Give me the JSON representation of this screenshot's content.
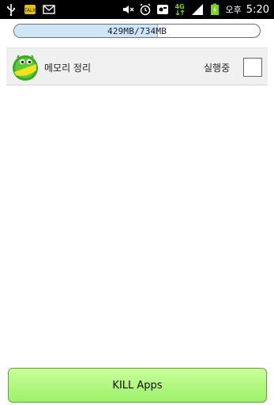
{
  "status_bar": {
    "left_icons": [
      "usb-icon",
      "kakaotalk-icon",
      "email-icon"
    ],
    "right_icons": [
      "mute-icon",
      "alarm-icon",
      "app-icon",
      "4g-icon",
      "signal-icon",
      "battery-charging-icon"
    ],
    "network_label": "4G",
    "ampm": "오후",
    "time": "5:20"
  },
  "memory": {
    "used_mb": 429,
    "total_mb": 734,
    "label": "429MB/734MB",
    "fill_color": "#cfe6f7"
  },
  "apps": [
    {
      "name": "메모리 정리",
      "status": "실행중",
      "icon": "green-cleaner-icon",
      "checked": false
    }
  ],
  "kill_button": {
    "label": "KILL Apps",
    "color": "#a6f270"
  }
}
